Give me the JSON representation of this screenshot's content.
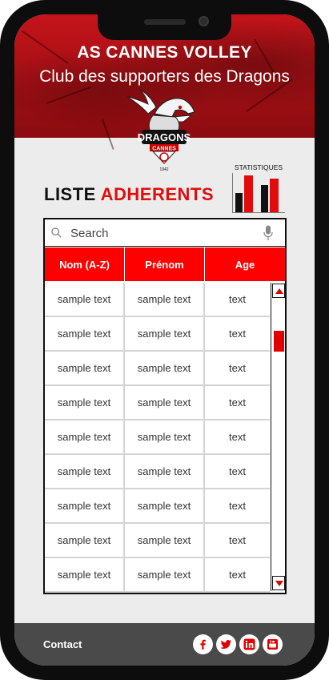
{
  "header": {
    "title": "AS CANNES VOLLEY",
    "subtitle": "Club des supporters des Dragons",
    "logo_text": "DRAGONS",
    "logo_subtext": "CANNES",
    "logo_year": "1942"
  },
  "page": {
    "heading_part1": "LISTE",
    "heading_part2": "ADHERENTS"
  },
  "stats": {
    "label": "STATISTIQUES",
    "bar_colors": [
      "#111111",
      "#e10d0d",
      "#111111",
      "#e10d0d"
    ]
  },
  "search": {
    "placeholder": "Search",
    "value": ""
  },
  "table": {
    "columns": [
      "Nom  (A-Z)",
      "Prénom",
      "Age"
    ],
    "rows": [
      [
        "sample text",
        "sample text",
        "text"
      ],
      [
        "sample text",
        "sample text",
        "text"
      ],
      [
        "sample text",
        "sample text",
        "text"
      ],
      [
        "sample text",
        "sample text",
        "text"
      ],
      [
        "sample text",
        "sample text",
        "text"
      ],
      [
        "sample text",
        "sample text",
        "text"
      ],
      [
        "sample text",
        "sample text",
        "text"
      ],
      [
        "sample text",
        "sample text",
        "text"
      ],
      [
        "sample text",
        "sample text",
        "text"
      ]
    ]
  },
  "footer": {
    "contact_label": "Contact",
    "social": [
      "facebook-icon",
      "twitter-icon",
      "linkedin-icon",
      "youtube-icon"
    ]
  },
  "colors": {
    "accent": "#ff0000",
    "banner": "#b31217",
    "footer": "#4a4a4a"
  }
}
